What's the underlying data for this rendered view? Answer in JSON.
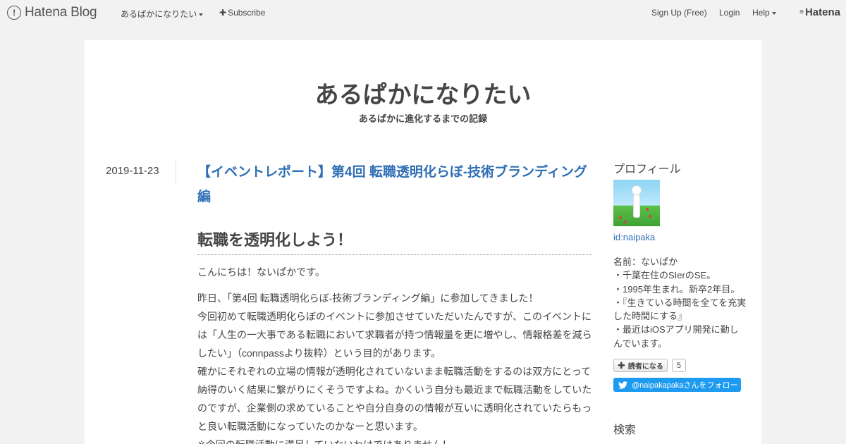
{
  "header": {
    "logo_text": "Hatena Blog",
    "blog_menu": "あるぱかになりたい",
    "subscribe": "Subscribe",
    "signup": "Sign Up (Free)",
    "login": "Login",
    "help": "Help",
    "hatena_logo": "Hatena"
  },
  "blog": {
    "title": "あるぱかになりたい",
    "description": "あるぱかに進化するまでの記録"
  },
  "entry": {
    "date": "2019-11-23",
    "title": "【イベントレポート】第4回 転職透明化らぼ-技術ブランディング編",
    "heading": "転職を透明化しよう！",
    "paragraph1": "こんにちは！ないぱかです。",
    "paragraph2": "昨日、「第4回 転職透明化らぼ-技術ブランディング編」に参加してきました！\n今回初めて転職透明化らぼのイベントに参加させていただいたんですが、このイベントには「人生の一大事である転職において求職者が持つ情報量を更に増やし、情報格差を減らしたい」（connpassより抜粋）という目的があります。\n確かにそれぞれの立場の情報が透明化されていないまま転職活動をするのは双方にとって納得のいく結果に繋がりにくそうですよね。かくいう自分も最近まで転職活動をしていたのですが、企業側の求めていることや自分自身のの情報が互いに透明化されていたらもっと良い転職活動になっていたのかなーと思います。",
    "paragraph3": "※今回の転職活動に満足していないわけではありません！"
  },
  "sidebar": {
    "profile_heading": "プロフィール",
    "user_id": "id:naipaka",
    "profile_text": "名前：ないぱか\n・千葉在住のSIerのSE。\n・1995年生まれ。新卒2年目。\n・『生きている時間を全てを充実した時間にする』\n・最近はiOSアプリ開発に勤しんでいます。",
    "reader_button": "読者になる",
    "reader_count": "5",
    "twitter_follow": "@naipakapakaさんをフォロー",
    "search_heading": "検索"
  },
  "colors": {
    "link": "#2f6fb5",
    "twitter": "#1d9bf0",
    "background": "#f2f2f2"
  },
  "icons": [
    "hatena-blog-logo-icon",
    "caret-down-icon",
    "plus-icon",
    "twitter-bird-icon"
  ]
}
